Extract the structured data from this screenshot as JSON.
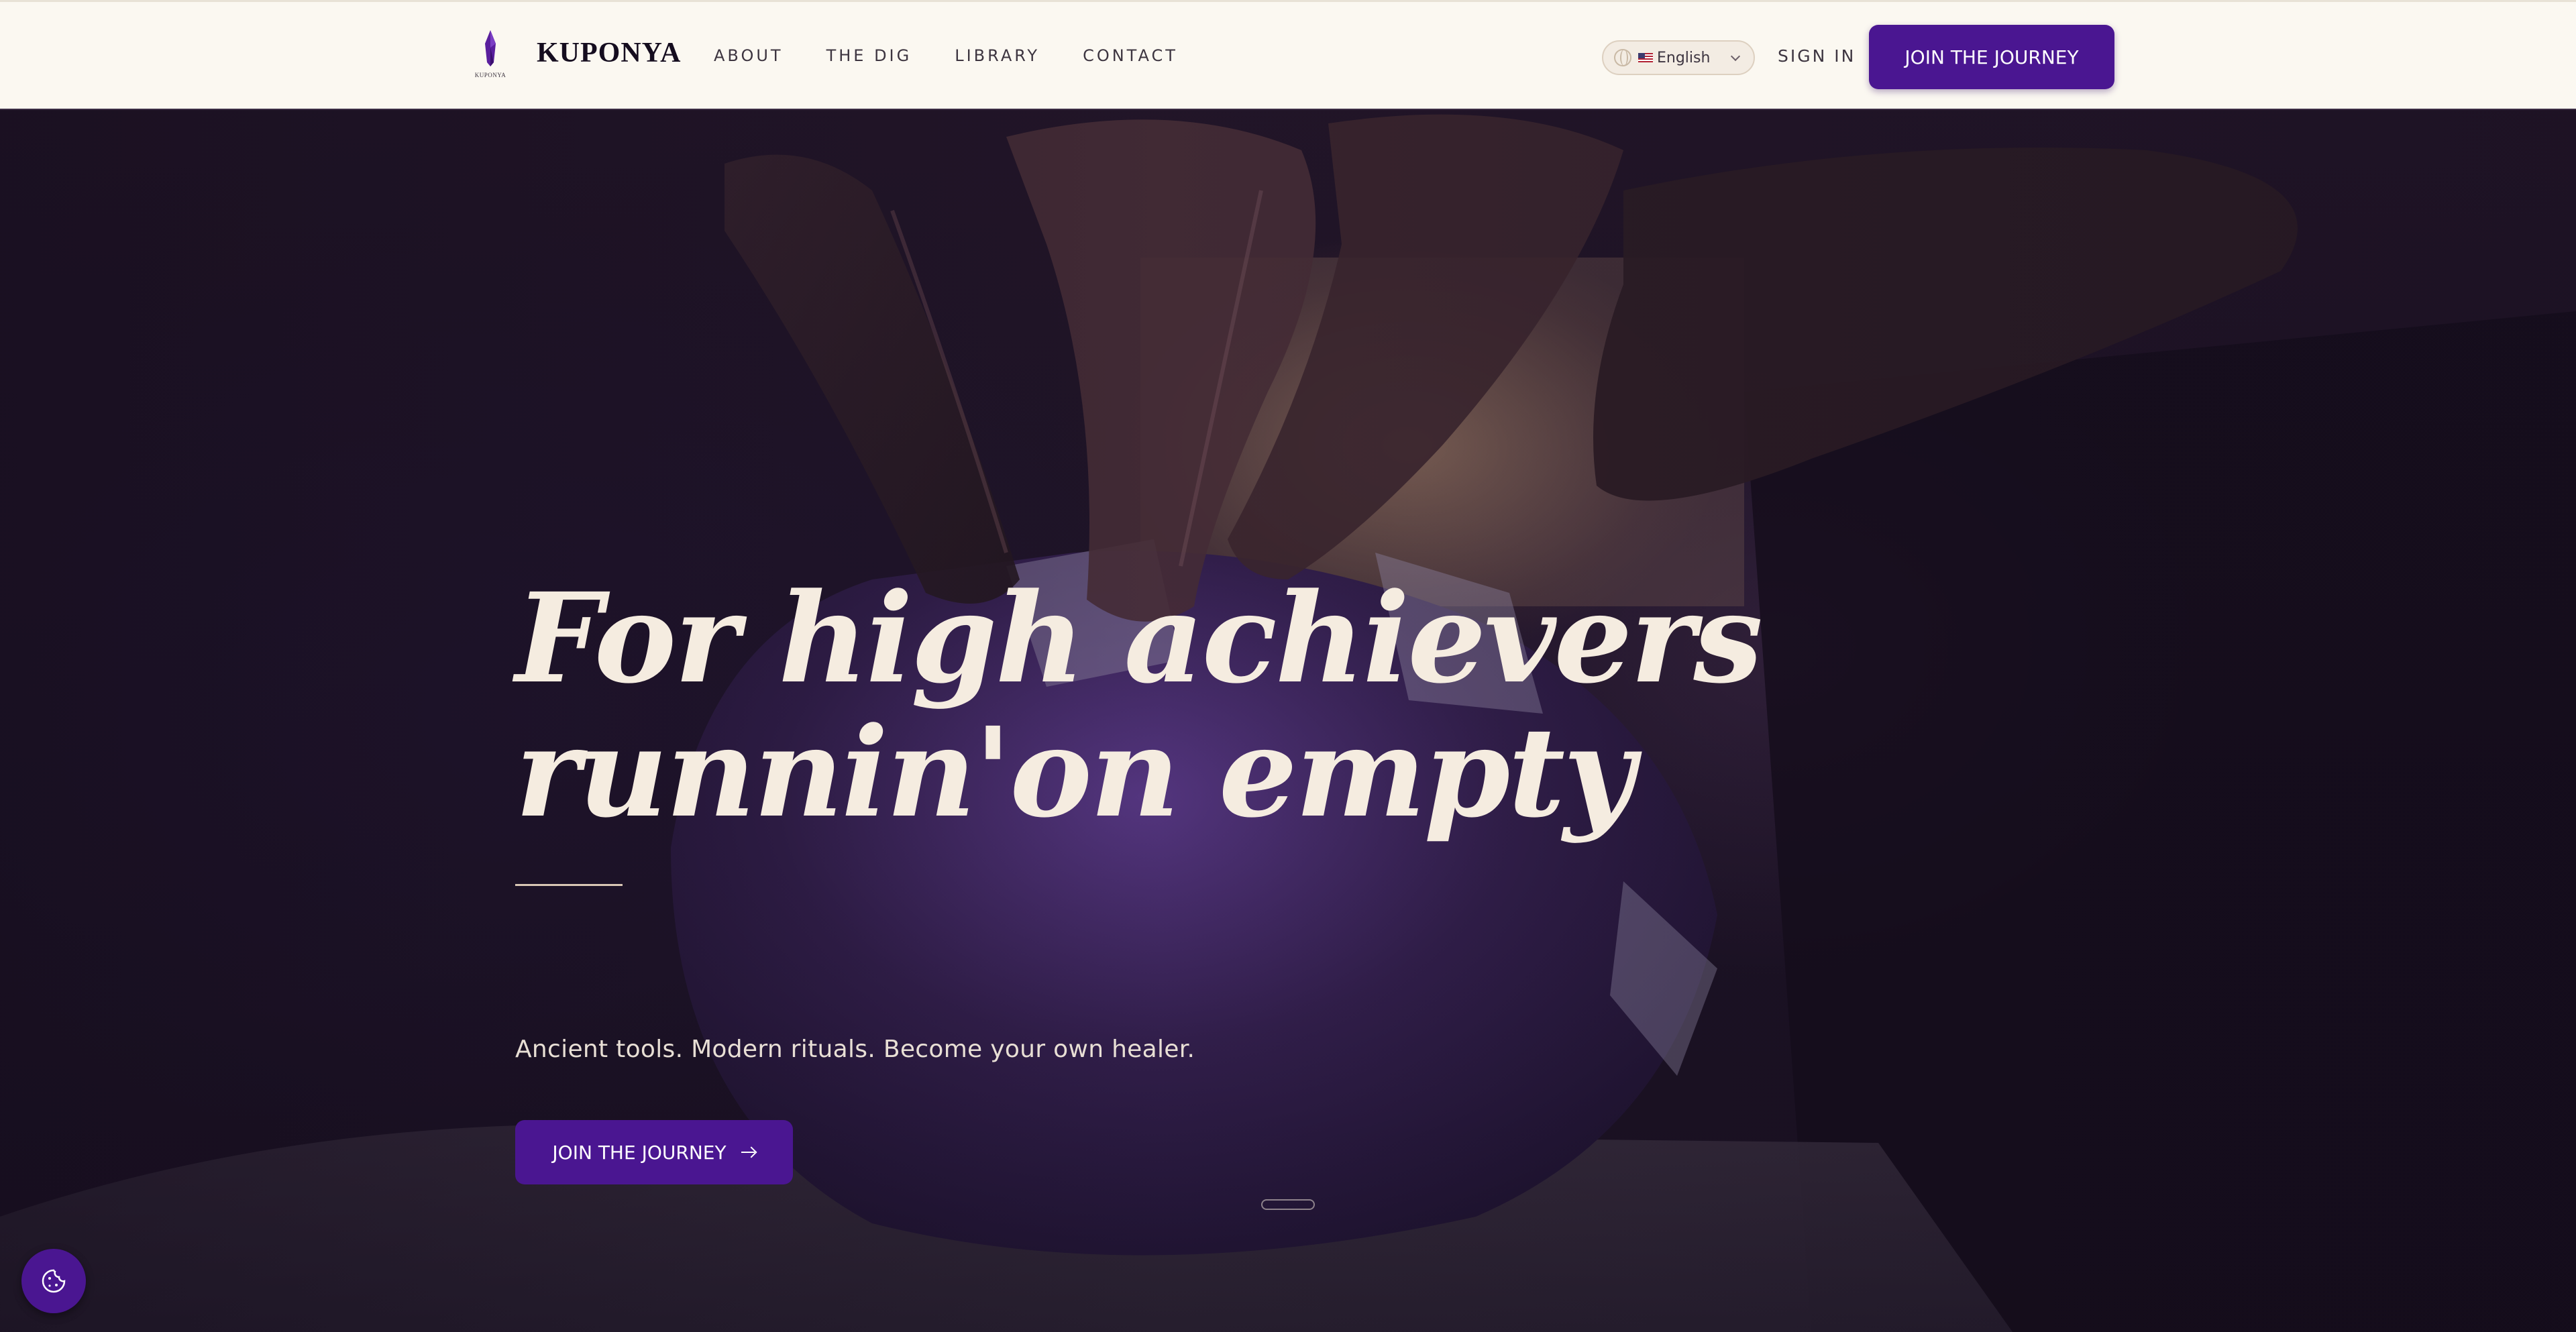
{
  "header": {
    "brand": "KUPONYA",
    "logo_caption": "KUPONYA",
    "nav": [
      {
        "label": "ABOUT"
      },
      {
        "label": "THE DIG"
      },
      {
        "label": "LIBRARY"
      },
      {
        "label": "CONTACT"
      }
    ],
    "language": {
      "selected": "English",
      "icon": "globe-icon",
      "flag": "us-flag"
    },
    "sign_in": "SIGN IN",
    "cta": "JOIN THE JOURNEY"
  },
  "hero": {
    "headline_line1": "For high achievers",
    "headline_line2": "runnin'on empty",
    "subhead": "Ancient tools. Modern rituals. Become your own healer.",
    "cta": "JOIN THE JOURNEY",
    "cta_icon": "arrow-right-icon",
    "scroll_icon": "scroll-indicator",
    "cookie_icon": "cookie-icon"
  },
  "colors": {
    "accent": "#4a1691",
    "header_bg": "#fbf8f1",
    "headline": "#f5ece0",
    "hero_bg": "#1d1326"
  }
}
